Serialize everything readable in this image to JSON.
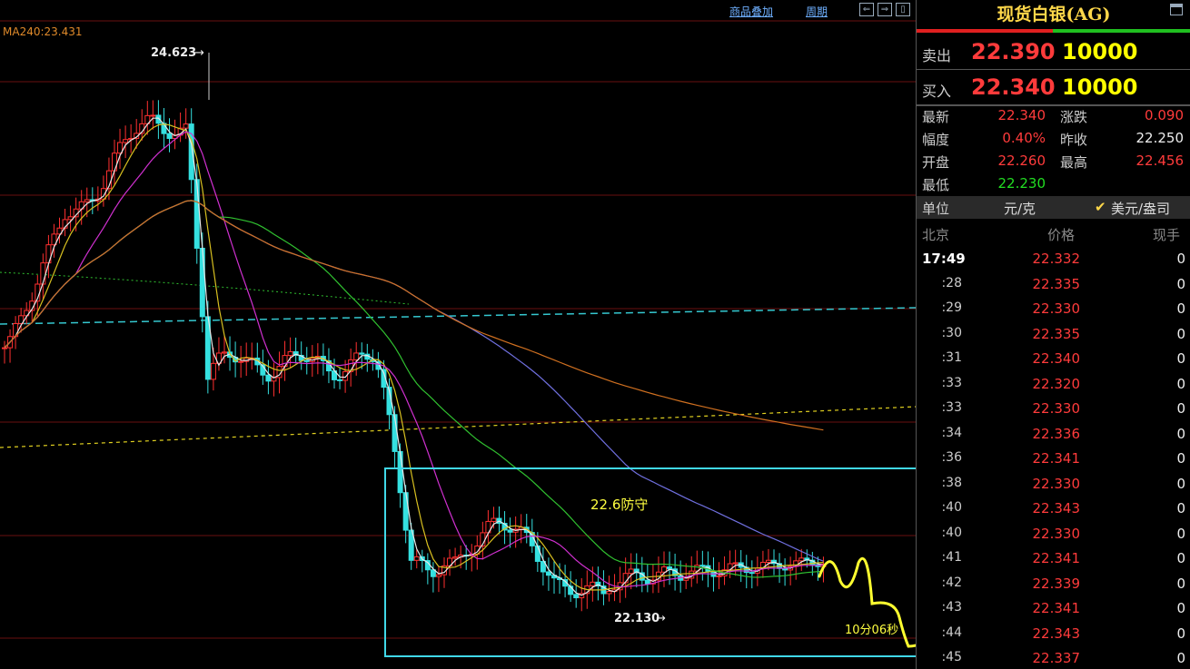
{
  "toolbar": {
    "overlay_label": "商品叠加",
    "period_label": "周期",
    "btn_prev": "⇐",
    "btn_next": "⇒",
    "btn_close": "▯"
  },
  "chart": {
    "ma_label": "MA240:23.431",
    "high_label": "24.623",
    "low_label": "22.130",
    "annot_defense": "22.6防守",
    "annot_time": "10分06秒"
  },
  "chart_data": {
    "type": "candlestick",
    "marked_high": 24.623,
    "marked_low": 22.13,
    "ma240": 23.431
  },
  "panel": {
    "title": "现货白银(AG)",
    "sell_label": "卖出",
    "sell_price": "22.390",
    "sell_vol": "10000",
    "buy_label": "买入",
    "buy_price": "22.340",
    "buy_vol": "10000",
    "stats": [
      {
        "label": "最新",
        "value": "22.340",
        "color": "#ff3b3b"
      },
      {
        "label": "涨跌",
        "value": "0.090",
        "color": "#ff3b3b"
      },
      {
        "label": "幅度",
        "value": "0.40%",
        "color": "#ff3b3b"
      },
      {
        "label": "昨收",
        "value": "22.250",
        "color": "#eeeeee"
      },
      {
        "label": "开盘",
        "value": "22.260",
        "color": "#ff3b3b"
      },
      {
        "label": "最高",
        "value": "22.456",
        "color": "#ff3b3b"
      },
      {
        "label": "最低",
        "value": "22.230",
        "color": "#22dd22"
      }
    ],
    "unit_label": "单位",
    "unit_cny": "元/克",
    "unit_usd": "美元/盎司",
    "tick_header": {
      "time": "北京",
      "price": "价格",
      "vol": "现手"
    },
    "ticks": [
      {
        "time": "17:49",
        "price": "22.332",
        "vol": "0"
      },
      {
        "time": ":28",
        "price": "22.335",
        "vol": "0"
      },
      {
        "time": ":29",
        "price": "22.330",
        "vol": "0"
      },
      {
        "time": ":30",
        "price": "22.335",
        "vol": "0"
      },
      {
        "time": ":31",
        "price": "22.340",
        "vol": "0"
      },
      {
        "time": ":33",
        "price": "22.320",
        "vol": "0"
      },
      {
        "time": ":33",
        "price": "22.330",
        "vol": "0"
      },
      {
        "time": ":34",
        "price": "22.336",
        "vol": "0"
      },
      {
        "time": ":36",
        "price": "22.341",
        "vol": "0"
      },
      {
        "time": ":38",
        "price": "22.330",
        "vol": "0"
      },
      {
        "time": ":40",
        "price": "22.343",
        "vol": "0"
      },
      {
        "time": ":40",
        "price": "22.330",
        "vol": "0"
      },
      {
        "time": ":41",
        "price": "22.341",
        "vol": "0"
      },
      {
        "time": ":42",
        "price": "22.339",
        "vol": "0"
      },
      {
        "time": ":43",
        "price": "22.341",
        "vol": "0"
      },
      {
        "time": ":44",
        "price": "22.343",
        "vol": "0"
      },
      {
        "time": ":45",
        "price": "22.337",
        "vol": "0"
      }
    ]
  }
}
